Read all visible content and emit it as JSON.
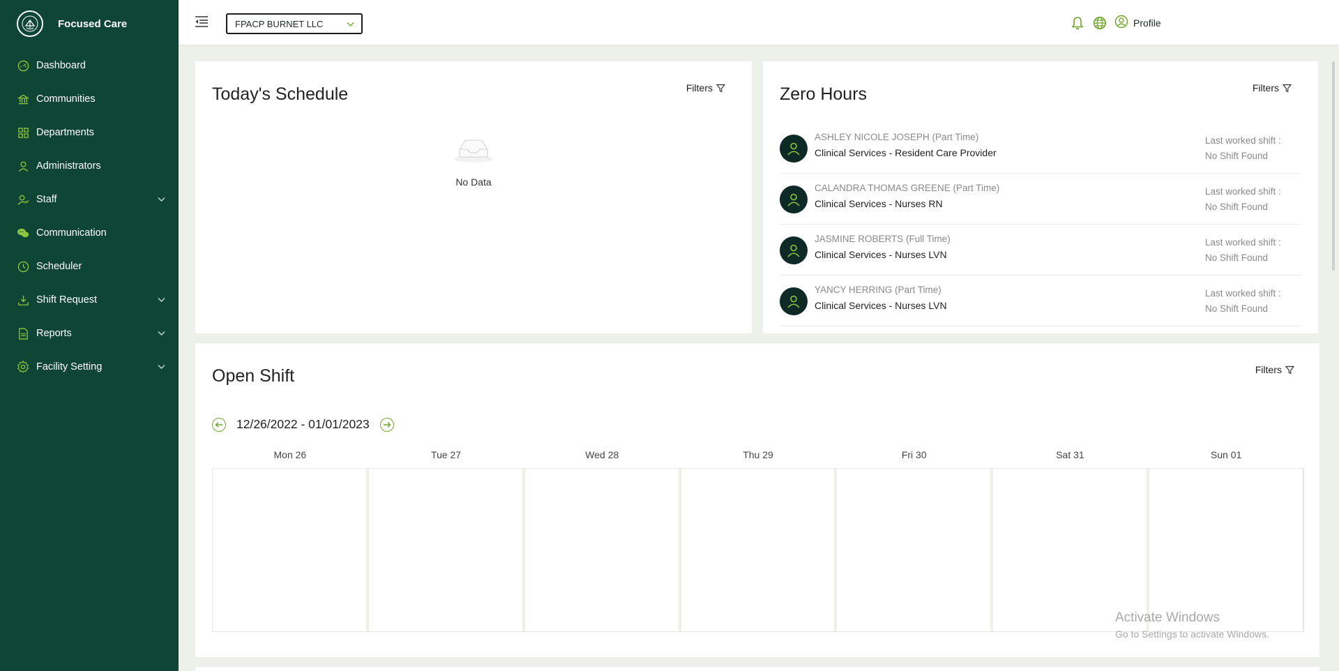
{
  "app": {
    "name": "Focused Care"
  },
  "colors": {
    "sidebar_bg": "#0f4535",
    "accent": "#6fa52b",
    "avatar_bg": "#0e2a26"
  },
  "sidebar": {
    "items": [
      {
        "label": "Dashboard",
        "icon": "dashboard-icon",
        "has_submenu": false
      },
      {
        "label": "Communities",
        "icon": "bank-icon",
        "has_submenu": false
      },
      {
        "label": "Departments",
        "icon": "grid-icon",
        "has_submenu": false
      },
      {
        "label": "Administrators",
        "icon": "user-icon",
        "has_submenu": false
      },
      {
        "label": "Staff",
        "icon": "staff-icon",
        "has_submenu": true
      },
      {
        "label": "Communication",
        "icon": "chat-icon",
        "has_submenu": false
      },
      {
        "label": "Scheduler",
        "icon": "clock-icon",
        "has_submenu": false
      },
      {
        "label": "Shift Request",
        "icon": "download-icon",
        "has_submenu": true
      },
      {
        "label": "Reports",
        "icon": "file-icon",
        "has_submenu": true
      },
      {
        "label": "Facility Setting",
        "icon": "gear-icon",
        "has_submenu": true
      }
    ]
  },
  "header": {
    "facility": "FPACP BURNET LLC",
    "profile_label": "Profile"
  },
  "todays_schedule": {
    "title": "Today's Schedule",
    "filters_label": "Filters",
    "empty_label": "No Data"
  },
  "zero_hours": {
    "title": "Zero Hours",
    "filters_label": "Filters",
    "rows": [
      {
        "name": "ASHLEY NICOLE JOSEPH (Part Time)",
        "dept": "Clinical Services - Resident Care Provider",
        "last_label": "Last worked shift :",
        "last_value": "No Shift Found"
      },
      {
        "name": "CALANDRA THOMAS GREENE (Part Time)",
        "dept": "Clinical Services - Nurses RN",
        "last_label": "Last worked shift :",
        "last_value": "No Shift Found"
      },
      {
        "name": "JASMINE ROBERTS (Full Time)",
        "dept": "Clinical Services - Nurses LVN",
        "last_label": "Last worked shift :",
        "last_value": "No Shift Found"
      },
      {
        "name": "YANCY HERRING (Part Time)",
        "dept": "Clinical Services - Nurses LVN",
        "last_label": "Last worked shift :",
        "last_value": "No Shift Found"
      }
    ]
  },
  "open_shift": {
    "title": "Open Shift",
    "filters_label": "Filters",
    "range": "12/26/2022 - 01/01/2023",
    "days": [
      "Mon 26",
      "Tue 27",
      "Wed 28",
      "Thu 29",
      "Fri 30",
      "Sat 31",
      "Sun 01"
    ]
  },
  "watermark": {
    "line1": "Activate Windows",
    "line2": "Go to Settings to activate Windows."
  }
}
